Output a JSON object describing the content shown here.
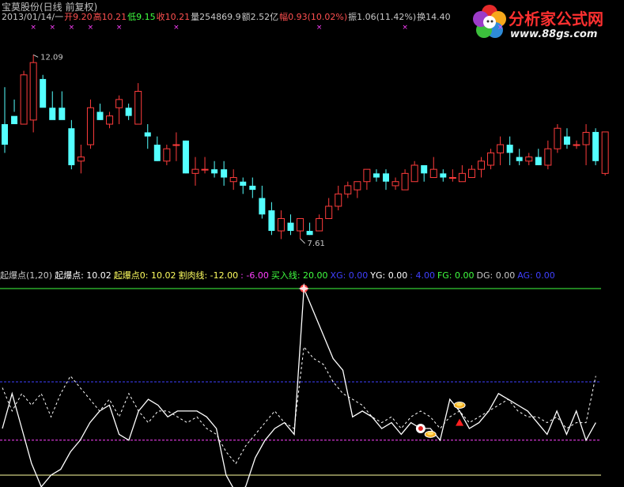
{
  "header": {
    "title": "宝莫股份(日线 前复权)",
    "quote": [
      {
        "text": "2013/01/14/一",
        "color": "#c8c8c8"
      },
      {
        "text": "开9.20",
        "color": "#ff5050"
      },
      {
        "text": "高10.21",
        "color": "#ff5050"
      },
      {
        "text": "低9.15",
        "color": "#40ff40"
      },
      {
        "text": "收10.21",
        "color": "#ff5050"
      },
      {
        "text": "量254869.9",
        "color": "#c8c8c8"
      },
      {
        "text": "额2.52亿",
        "color": "#c8c8c8"
      },
      {
        "text": "幅0.93(10.02%)",
        "color": "#ff5050"
      },
      {
        "text": "振1.06(11.42%)",
        "color": "#c8c8c8"
      },
      {
        "text": "换14.40",
        "color": "#c8c8c8"
      }
    ]
  },
  "logo": {
    "name": "分析家公式网",
    "url": "www.88gs.com"
  },
  "indicator_bar": [
    {
      "text": "起爆点(1,20)",
      "color": "#c8c8c8"
    },
    {
      "text": "起爆点: 10.02",
      "color": "#ffffff"
    },
    {
      "text": "起爆点0: 10.02",
      "color": "#ffff60"
    },
    {
      "text": "割肉线: -12.00",
      "color": "#ffff60"
    },
    {
      "text": ": -6.00",
      "color": "#ff40ff"
    },
    {
      "text": "买入线: 20.00",
      "color": "#40ff40"
    },
    {
      "text": "XG: 0.00",
      "color": "#4040ff"
    },
    {
      "text": "YG: 0.00",
      "color": "#ffffff"
    },
    {
      "text": ": 4.00",
      "color": "#4040ff"
    },
    {
      "text": "FG: 0.00",
      "color": "#40ff40"
    },
    {
      "text": "DG: 0.00",
      "color": "#c8c8c8"
    },
    {
      "text": "AG: 0.00",
      "color": "#4040ff"
    }
  ],
  "colors": {
    "up": "#ff3c3c",
    "down": "#54ffff",
    "buy_line": "#40ff40",
    "blue_line": "#4040ff",
    "magenta_line": "#ff40ff",
    "bottom_line": "#ffffa0"
  },
  "chart_data": [
    {
      "type": "candlestick",
      "title": "宝莫股份(日线 前复权)",
      "ylim": [
        7.3,
        12.5
      ],
      "annotations": [
        {
          "text": "12.09",
          "price": 12.09,
          "index": 3
        },
        {
          "text": "7.61",
          "price": 7.61,
          "index": 31
        }
      ],
      "markers": {
        "symbol": "×",
        "indices": [
          3,
          5,
          7,
          9,
          12,
          18,
          33,
          42,
          52
        ]
      },
      "candles": [
        [
          10.4,
          11.3,
          9.9,
          9.7
        ],
        [
          10.6,
          11.0,
          10.4,
          10.7
        ],
        [
          10.4,
          11.7,
          11.6,
          10.5
        ],
        [
          10.5,
          12.09,
          11.9,
          10.2
        ],
        [
          11.5,
          11.6,
          10.8,
          11.0
        ],
        [
          10.8,
          11.2,
          10.5,
          10.7
        ],
        [
          10.8,
          11.2,
          10.5,
          10.6
        ],
        [
          10.3,
          10.5,
          9.4,
          9.3
        ],
        [
          9.5,
          9.9,
          9.6,
          9.2
        ],
        [
          9.9,
          11.0,
          10.8,
          9.8
        ],
        [
          10.7,
          10.9,
          10.5,
          10.5
        ],
        [
          10.4,
          10.7,
          10.6,
          10.3
        ],
        [
          10.8,
          11.1,
          11.0,
          10.4
        ],
        [
          10.8,
          10.9,
          10.6,
          10.5
        ],
        [
          10.4,
          11.4,
          11.2,
          10.4
        ],
        [
          10.2,
          10.4,
          10.1,
          9.8
        ],
        [
          9.9,
          10.1,
          9.5,
          9.5
        ],
        [
          9.5,
          9.9,
          9.8,
          9.4
        ],
        [
          9.9,
          10.2,
          9.9,
          9.5
        ],
        [
          10.0,
          10.0,
          9.2,
          9.2
        ],
        [
          9.2,
          9.6,
          9.3,
          8.9
        ],
        [
          9.3,
          9.6,
          9.3,
          9.2
        ],
        [
          9.3,
          9.5,
          9.2,
          9.1
        ],
        [
          9.3,
          9.5,
          9.1,
          8.9
        ],
        [
          9.0,
          9.3,
          9.1,
          8.8
        ],
        [
          9.0,
          9.1,
          8.9,
          8.7
        ],
        [
          8.9,
          9.1,
          8.8,
          8.6
        ],
        [
          8.6,
          8.9,
          8.2,
          8.1
        ],
        [
          8.3,
          8.5,
          7.8,
          7.7
        ],
        [
          7.8,
          8.3,
          8.1,
          7.6
        ],
        [
          8.0,
          8.2,
          7.8,
          7.7
        ],
        [
          7.8,
          8.1,
          8.1,
          7.61
        ],
        [
          7.8,
          8.0,
          7.7,
          7.7
        ],
        [
          7.8,
          8.2,
          8.1,
          7.8
        ],
        [
          8.1,
          8.6,
          8.4,
          8.1
        ],
        [
          8.4,
          8.9,
          8.7,
          8.3
        ],
        [
          8.7,
          9.0,
          8.9,
          8.6
        ],
        [
          8.8,
          9.0,
          9.0,
          8.6
        ],
        [
          9.0,
          9.3,
          9.3,
          8.8
        ],
        [
          9.2,
          9.3,
          9.1,
          9.0
        ],
        [
          9.2,
          9.3,
          9.0,
          8.8
        ],
        [
          8.9,
          9.1,
          9.0,
          8.8
        ],
        [
          8.8,
          9.3,
          9.2,
          8.8
        ],
        [
          9.0,
          9.5,
          9.4,
          9.0
        ],
        [
          9.4,
          9.4,
          9.2,
          9.0
        ],
        [
          9.1,
          9.6,
          9.3,
          9.1
        ],
        [
          9.2,
          9.3,
          9.1,
          9.0
        ],
        [
          9.1,
          9.3,
          9.1,
          9.0
        ],
        [
          9.0,
          9.4,
          9.2,
          9.0
        ],
        [
          9.1,
          9.4,
          9.3,
          9.1
        ],
        [
          9.3,
          9.6,
          9.5,
          9.1
        ],
        [
          9.4,
          9.8,
          9.7,
          9.3
        ],
        [
          9.7,
          10.1,
          9.9,
          9.4
        ],
        [
          9.9,
          10.1,
          9.7,
          9.4
        ],
        [
          9.6,
          9.8,
          9.5,
          9.4
        ],
        [
          9.5,
          9.7,
          9.6,
          9.4
        ],
        [
          9.6,
          9.8,
          9.4,
          9.4
        ],
        [
          9.4,
          10.0,
          9.8,
          9.3
        ],
        [
          9.8,
          10.4,
          10.3,
          9.7
        ],
        [
          10.1,
          10.3,
          9.9,
          9.8
        ],
        [
          9.9,
          10.0,
          9.9,
          9.8
        ],
        [
          9.9,
          10.4,
          10.2,
          9.4
        ],
        [
          10.21,
          10.3,
          9.5,
          9.4
        ],
        [
          9.2,
          10.21,
          10.21,
          9.15
        ]
      ]
    },
    {
      "type": "line",
      "title": "起爆点(1,20)",
      "ylim": [
        -12,
        20
      ],
      "reference_lines": [
        {
          "name": "买入线",
          "value": 20,
          "color": "#40ff40"
        },
        {
          "value": 4,
          "color": "#4040ff"
        },
        {
          "value": -6,
          "color": "#ff40ff"
        },
        {
          "name": "割肉线",
          "value": -12,
          "color": "#ffffa0"
        }
      ],
      "series": [
        {
          "name": "起爆点",
          "color": "#ffffff",
          "style": "solid",
          "values": [
            -4,
            2,
            -4,
            -10,
            -14,
            -12,
            -11,
            -8,
            -6,
            -3,
            -1,
            0,
            -5,
            -6,
            -1,
            1,
            0,
            -2,
            -1,
            -1,
            -1,
            -2,
            -4,
            -12,
            -15,
            -14,
            -9,
            -6,
            -4,
            -3,
            -5,
            20,
            16,
            12,
            8,
            6,
            -2,
            -1,
            -2,
            -4,
            -3,
            -5,
            -3,
            -4,
            -4,
            -6,
            1,
            -1,
            -4,
            -3,
            -1,
            2,
            1,
            0,
            -1,
            -3,
            -5,
            -1,
            -5,
            -1,
            -6,
            -3
          ]
        },
        {
          "name": "起爆点0",
          "color": "#ffffff",
          "style": "dashed",
          "values": [
            3,
            -1,
            2,
            0,
            2,
            -2,
            2,
            5,
            3,
            1,
            -1,
            1,
            -2,
            2,
            -1,
            -3,
            -1,
            -1,
            -2,
            -3,
            -2,
            -4,
            -5,
            -8,
            -10,
            -7,
            -5,
            -3,
            -1,
            -3,
            -4,
            10,
            8,
            7,
            4,
            2,
            1,
            0,
            -2,
            -3,
            -2,
            -4,
            -2,
            -1,
            -2,
            -4,
            -2,
            -1,
            -3,
            -2,
            -1,
            0,
            1,
            -1,
            -2,
            -2,
            -3,
            -2,
            -4,
            -3,
            -3,
            5
          ]
        }
      ],
      "icons": [
        {
          "name": "star-icon",
          "index": 31,
          "value": 20
        },
        {
          "name": "pin-icon",
          "index": 43,
          "value": -4
        },
        {
          "name": "coin-icon",
          "index": 44,
          "value": -5
        },
        {
          "name": "coin-icon",
          "index": 47,
          "value": 0
        },
        {
          "name": "triangle-up-icon",
          "index": 47,
          "value": -3
        }
      ]
    }
  ]
}
